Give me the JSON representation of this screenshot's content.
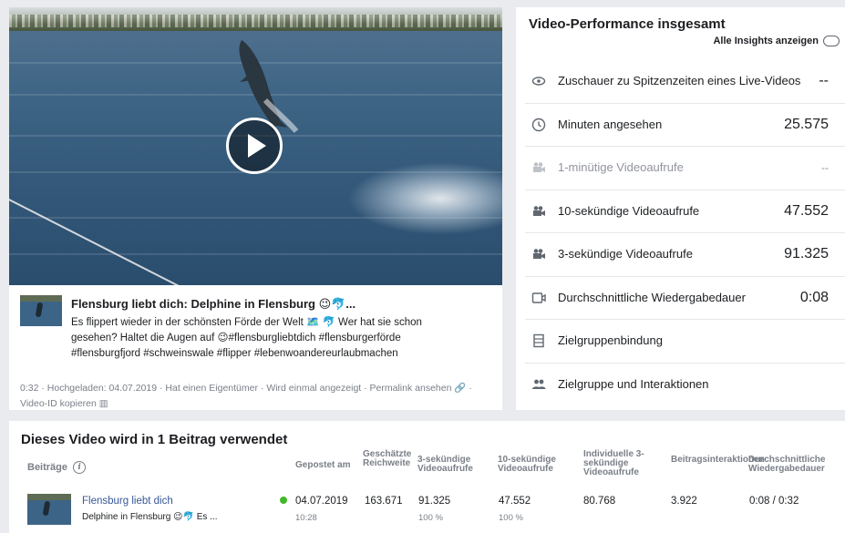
{
  "video": {
    "title": "Flensburg liebt dich: Delphine in Flensburg 😉🐬...",
    "description_line1": "Es flippert wieder in der schönsten Förde der Welt 🗺️ 🐬 Wer hat sie schon",
    "description_line2": "gesehen? Haltet die Augen auf 😉#flensburgliebtdich #flensburgerförde",
    "description_line3": "#flensburgfjord #schweinswale #flipper #lebenwoandereurlaubmachen",
    "duration": "0:32",
    "uploaded": "Hochgeladen: 04.07.2019",
    "owner": "Hat einen Eigentümer",
    "shown": "Wird einmal angezeigt",
    "permalink": "Permalink ansehen",
    "copy_id": "Video-ID kopieren",
    "sep": "·"
  },
  "performance": {
    "title": "Video-Performance insgesamt",
    "insights_label": "Alle Insights anzeigen",
    "metrics": [
      {
        "label": "Zuschauer zu Spitzenzeiten eines Live-Videos",
        "value": "--",
        "icon": "eye-icon"
      },
      {
        "label": "Minuten angesehen",
        "value": "25.575",
        "icon": "clock-icon"
      },
      {
        "label": "1-minütige Videoaufrufe",
        "value": "--",
        "icon": "video-camera-icon"
      },
      {
        "label": "10-sekündige Videoaufrufe",
        "value": "47.552",
        "icon": "video-camera-icon"
      },
      {
        "label": "3-sekündige Videoaufrufe",
        "value": "91.325",
        "icon": "video-camera-icon"
      },
      {
        "label": "Durchschnittliche Wiedergabedauer",
        "value": "0:08",
        "icon": "playback-icon"
      },
      {
        "label": "Zielgruppenbindung",
        "value": "",
        "icon": "film-strip-icon"
      },
      {
        "label": "Zielgruppe und Interaktionen",
        "value": "",
        "icon": "people-icon"
      }
    ]
  },
  "usage": {
    "title": "Dieses Video wird in 1 Beitrag verwendet",
    "headers": {
      "posts": "Beiträge",
      "posted": "Gepostet am",
      "reach": "Geschätzte Reichweite",
      "views3": "3-sekündige Videoaufrufe",
      "views10": "10-sekündige Videoaufrufe",
      "individual3": "Individuelle 3-sekündige Videoaufrufe",
      "interactions": "Beitragsinteraktionen",
      "avg_duration": "Durchschnittliche Wiedergabedauer"
    },
    "row": {
      "post_title": "Flensburg liebt dich",
      "post_sub": "Delphine in Flensburg 😉🐬 Es ...",
      "posted_date": "04.07.2019",
      "posted_time": "10:28",
      "reach": "163.671",
      "views3": "91.325",
      "views3_pct": "100 %",
      "views10": "47.552",
      "views10_pct": "100 %",
      "individual3": "80.768",
      "interactions": "3.922",
      "avg_duration": "0:08 / 0:32"
    }
  },
  "colors": {
    "link": "#385898",
    "status_green": "#42b72a",
    "muted": "#7a7f87",
    "background": "#e9ebee"
  }
}
